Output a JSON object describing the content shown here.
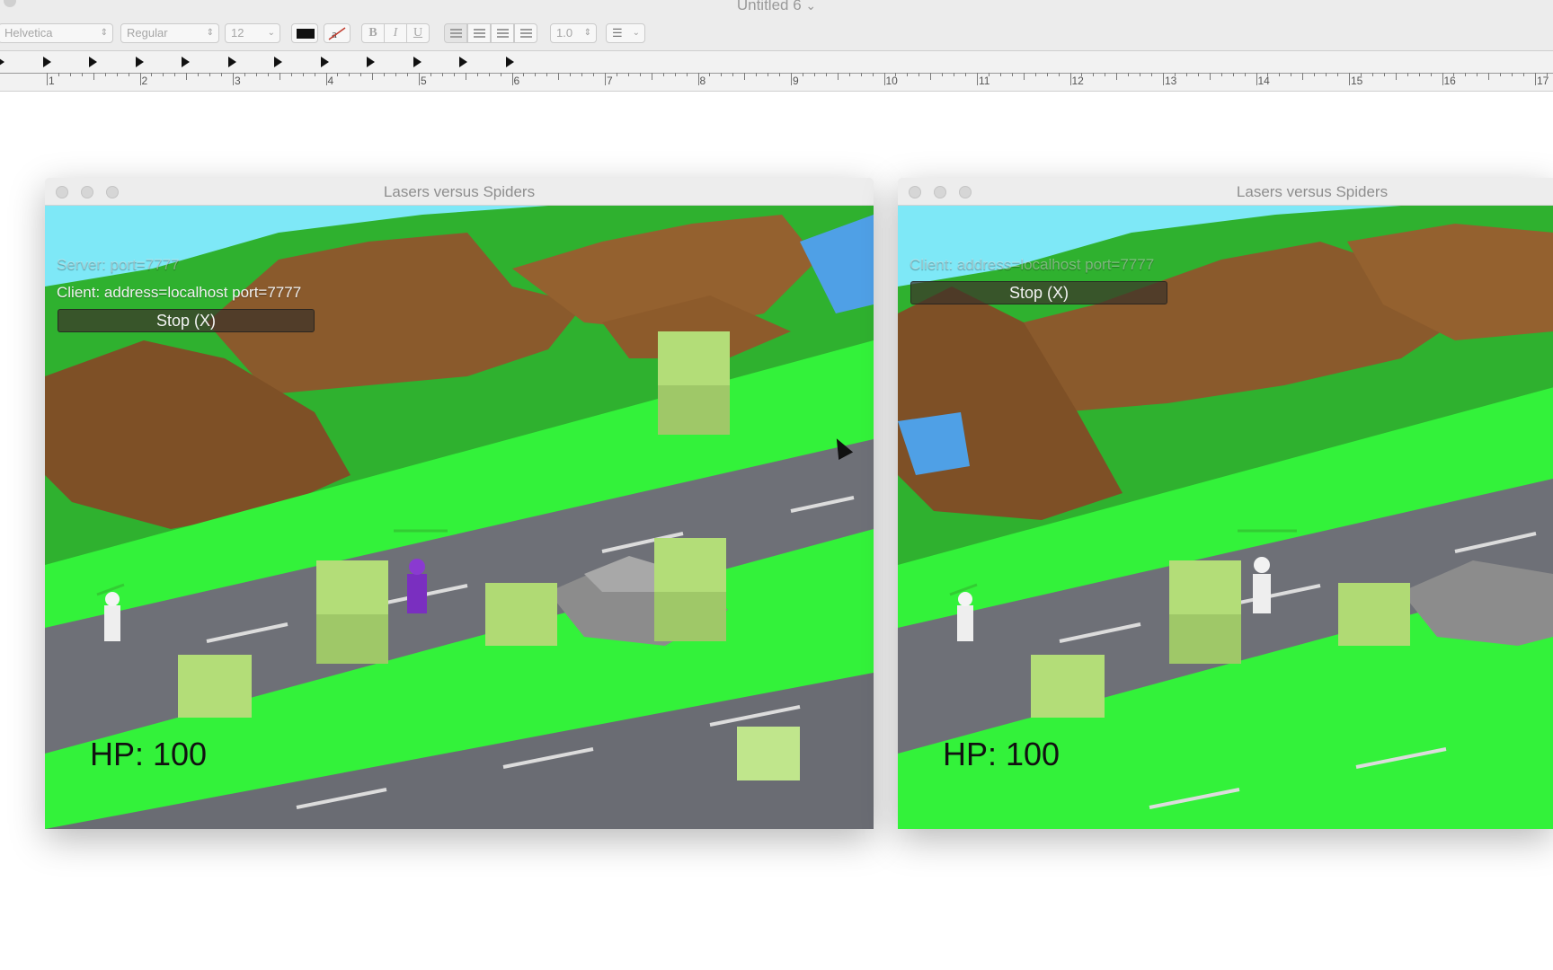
{
  "app": {
    "document_title": "Untitled 6",
    "title_chevron": "⌄"
  },
  "toolbar": {
    "font_family": "Helvetica",
    "font_style": "Regular",
    "font_size": "12",
    "bold_label": "B",
    "italic_label": "I",
    "underline_label": "U",
    "line_spacing": "1.0",
    "text_color": "#111111"
  },
  "ruler": {
    "numbers": [
      "1",
      "2",
      "3",
      "4",
      "5",
      "6",
      "7",
      "8",
      "9",
      "10",
      "11",
      "12",
      "13",
      "14",
      "15",
      "16",
      "17"
    ]
  },
  "windows": [
    {
      "title": "Lasers versus Spiders",
      "hud_line1": "Server: port=7777",
      "hud_line2": "Client: address=localhost port=7777",
      "stop_label": "Stop (X)",
      "hp": "HP: 100"
    },
    {
      "title": "Lasers versus Spiders",
      "hud_line1": "Client: address=localhost port=7777",
      "stop_label": "Stop (X)",
      "hp": "HP: 100"
    }
  ],
  "colors": {
    "sky": "#7ee8f7",
    "grass": "#33f23a",
    "road": "#6e7077",
    "dirt": "#8b5a2b",
    "bush": "#b6dc7a"
  }
}
